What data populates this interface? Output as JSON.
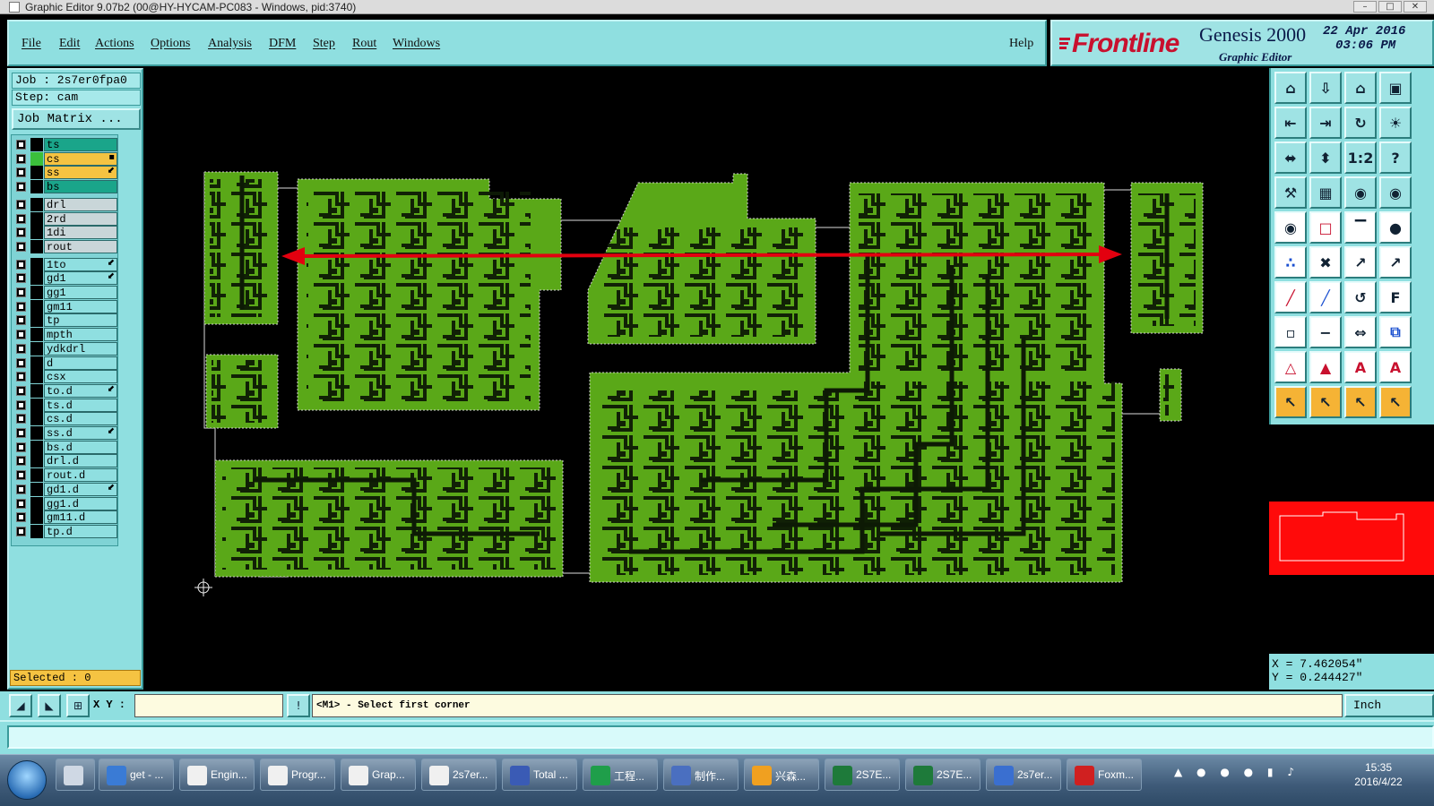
{
  "window": {
    "title": "Graphic Editor 9.07b2 (00@HY-HYCAM-PC083 - Windows, pid:3740)"
  },
  "menu": {
    "items": [
      "File",
      "Edit",
      "Actions",
      "Options",
      "Analysis",
      "DFM",
      "Step",
      "Rout",
      "Windows"
    ],
    "help": "Help"
  },
  "brand": {
    "company": "Frontline",
    "product": "Genesis 2000",
    "subtitle": "Graphic Editor",
    "date": "22 Apr 2016",
    "time": "03:06 PM"
  },
  "job": {
    "job_line": "Job : 2s7er0fpa0",
    "step_line": "Step: cam",
    "matrix_button": "Job Matrix ..."
  },
  "layers": [
    {
      "name": "ts",
      "color": "#1aa58a",
      "mark": "",
      "sw": "#000000"
    },
    {
      "name": "cs",
      "color": "#f5c342",
      "mark": "▪",
      "sw": "#3bbf3b"
    },
    {
      "name": "ss",
      "color": "#f5c342",
      "mark": "⬋",
      "sw": "#000000"
    },
    {
      "name": "bs",
      "color": "#1aa58a",
      "mark": "",
      "sw": "#000000"
    },
    {
      "name": "drl",
      "color": "#c9d6d9",
      "mark": "",
      "sw": "#000000"
    },
    {
      "name": "2rd",
      "color": "#c9d6d9",
      "mark": "",
      "sw": "#000000"
    },
    {
      "name": "1di",
      "color": "#c9d6d9",
      "mark": "",
      "sw": "#000000"
    },
    {
      "name": "rout",
      "color": "#c9d6d9",
      "mark": "",
      "sw": "#000000"
    },
    {
      "name": "1to",
      "color": "#8fdfe0",
      "mark": "⬋",
      "sw": "#000000"
    },
    {
      "name": "gd1",
      "color": "#8fdfe0",
      "mark": "⬋",
      "sw": "#000000"
    },
    {
      "name": "gg1",
      "color": "#8fdfe0",
      "mark": "",
      "sw": "#000000"
    },
    {
      "name": "gm11",
      "color": "#8fdfe0",
      "mark": "",
      "sw": "#000000"
    },
    {
      "name": "tp",
      "color": "#8fdfe0",
      "mark": "",
      "sw": "#000000"
    },
    {
      "name": "mpth",
      "color": "#8fdfe0",
      "mark": "",
      "sw": "#000000"
    },
    {
      "name": "ydkdrl",
      "color": "#8fdfe0",
      "mark": "",
      "sw": "#000000"
    },
    {
      "name": "d",
      "color": "#8fdfe0",
      "mark": "",
      "sw": "#000000"
    },
    {
      "name": "csx",
      "color": "#8fdfe0",
      "mark": "",
      "sw": "#000000"
    },
    {
      "name": "to.d",
      "color": "#8fdfe0",
      "mark": "⬋",
      "sw": "#000000"
    },
    {
      "name": "ts.d",
      "color": "#8fdfe0",
      "mark": "",
      "sw": "#000000"
    },
    {
      "name": "cs.d",
      "color": "#8fdfe0",
      "mark": "",
      "sw": "#000000"
    },
    {
      "name": "ss.d",
      "color": "#8fdfe0",
      "mark": "⬋",
      "sw": "#000000"
    },
    {
      "name": "bs.d",
      "color": "#8fdfe0",
      "mark": "",
      "sw": "#000000"
    },
    {
      "name": "drl.d",
      "color": "#8fdfe0",
      "mark": "",
      "sw": "#000000"
    },
    {
      "name": "rout.d",
      "color": "#8fdfe0",
      "mark": "",
      "sw": "#000000"
    },
    {
      "name": "gd1.d",
      "color": "#8fdfe0",
      "mark": "⬋",
      "sw": "#000000"
    },
    {
      "name": "gg1.d",
      "color": "#8fdfe0",
      "mark": "",
      "sw": "#000000"
    },
    {
      "name": "gm11.d",
      "color": "#8fdfe0",
      "mark": "",
      "sw": "#000000"
    },
    {
      "name": "tp.d",
      "color": "#8fdfe0",
      "mark": "",
      "sw": "#000000"
    }
  ],
  "selected": "Selected : 0",
  "colors": {
    "board_green": "#5aa818",
    "trace_dark": "#0d1a05",
    "measure_arrow": "#e3000f",
    "overview_red": "#ff0a0a"
  },
  "coords": {
    "x": "X = 7.462054\"",
    "y": "Y = 0.244427\""
  },
  "cmd": {
    "xy_label": "X Y :",
    "xy_value": "",
    "prompt": "<M1> - Select first corner",
    "units": "Inch"
  },
  "tools": [
    "home-icon",
    "stack-down-icon",
    "house-icon",
    "window-icon",
    "zoom-back-icon",
    "zoom-forward-icon",
    "rotate-icon",
    "lamp-icon",
    "fit-all-icon",
    "fit-selected-icon",
    "scale-12-icon",
    "help-icon",
    "wrench-icon",
    "grid-icon",
    "snap-a-icon",
    "snap-b-icon",
    "record-icon",
    "erase-icon",
    "measure-bar-icon",
    "dot-icon",
    "node-icon",
    "cross-icon",
    "move-point-icon",
    "arrow-icon",
    "line-red-icon",
    "line-blue-icon",
    "arc-icon",
    "text-f-icon",
    "square-point-icon",
    "minus-icon",
    "fit-h-icon",
    "copy-icon",
    "triangle-a-icon",
    "triangle-b-icon",
    "triangle-c-icon",
    "triangle-d-icon",
    "pointer-a-icon",
    "pointer-b-icon",
    "pointer-c-icon",
    "pointer-d-icon"
  ],
  "taskbar": {
    "items": [
      {
        "label": "get - ...",
        "color": "#3a7bd5"
      },
      {
        "label": "Engin...",
        "color": "#f0f0f0"
      },
      {
        "label": "Progr...",
        "color": "#f0f0f0"
      },
      {
        "label": "Grap...",
        "color": "#f0f0f0"
      },
      {
        "label": "2s7er...",
        "color": "#f0f0f0"
      },
      {
        "label": "Total ...",
        "color": "#3a5bb5"
      },
      {
        "label": "工程...",
        "color": "#1f9e4a"
      },
      {
        "label": "制作...",
        "color": "#4a6fc0"
      },
      {
        "label": "兴森...",
        "color": "#f0a020"
      },
      {
        "label": "2S7E...",
        "color": "#1e7a3a"
      },
      {
        "label": "2S7E...",
        "color": "#1e7a3a"
      },
      {
        "label": "2s7er...",
        "color": "#3a6fd0"
      },
      {
        "label": "Foxm...",
        "color": "#d02020"
      }
    ],
    "clock_time": "15:35",
    "clock_date": "2016/4/22"
  }
}
